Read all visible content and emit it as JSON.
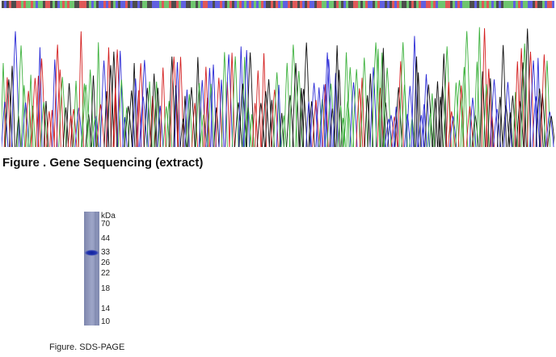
{
  "sequencing_figure": {
    "caption": "Figure . Gene Sequencing (extract)",
    "trace_colors": {
      "A": "#3fb23f",
      "C": "#2b2bd6",
      "G": "#111111",
      "T": "#d42020"
    }
  },
  "sds_page_figure": {
    "caption": "Figure. SDS-PAGE",
    "unit_label": "kDa",
    "markers": [
      "70",
      "44",
      "33",
      "26",
      "22",
      "18",
      "14",
      "10"
    ],
    "band_marker": "33",
    "lane_color": "#8f98bd",
    "band_color": "#1e2fa8"
  }
}
